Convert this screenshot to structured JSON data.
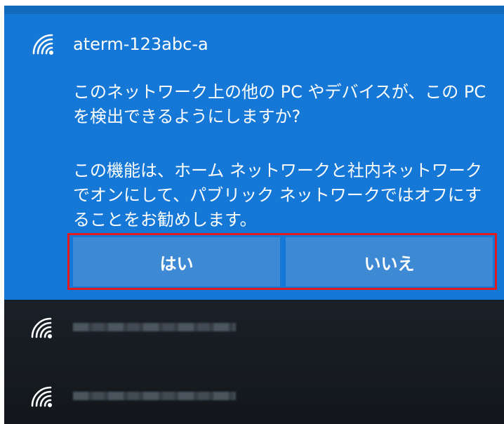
{
  "prompt": {
    "network_name": "aterm-123abc-a",
    "question": "このネットワーク上の他の PC やデバイスが、この PC を検出できるようにしますか?",
    "recommendation": "この機能は、ホーム ネットワークと社内ネットワークでオンにして、パブリック ネットワークではオフにすることをお勧めします。",
    "yes_label": "はい",
    "no_label": "いいえ",
    "colors": {
      "panel": "#1578d6",
      "button": "#3d89d4",
      "highlight": "#e01c1c",
      "list_background": "#15191e"
    }
  },
  "network_list": {
    "items": [
      {
        "icon": "wifi-icon"
      },
      {
        "icon": "wifi-icon"
      }
    ]
  }
}
